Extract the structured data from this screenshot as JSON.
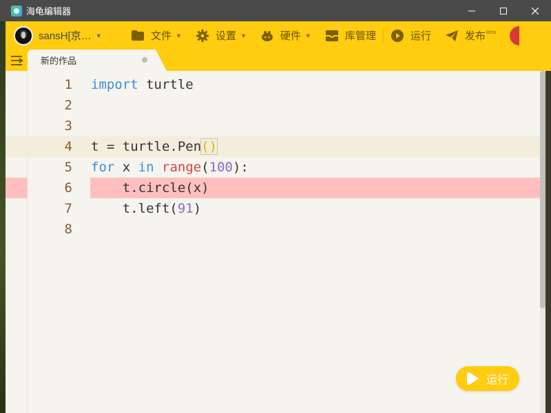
{
  "window": {
    "title": "海龟编辑器",
    "controls": {
      "minimize": "—",
      "maximize": "☐",
      "close": "✕"
    }
  },
  "toolbar": {
    "user_name": "sansH[京…",
    "items": [
      {
        "label": "文件",
        "icon": "folder-icon"
      },
      {
        "label": "设置",
        "icon": "gear-icon"
      },
      {
        "label": "硬件",
        "icon": "hardware-icon"
      },
      {
        "label": "库管理",
        "icon": "box-icon"
      },
      {
        "label": "运行",
        "icon": "play-icon"
      },
      {
        "label": "发布",
        "icon": "send-icon",
        "badge": "Beta"
      }
    ]
  },
  "tabs": [
    {
      "label": "新的作品"
    }
  ],
  "editor": {
    "line_numbers": [
      "1",
      "2",
      "3",
      "4",
      "5",
      "6",
      "7",
      "8"
    ],
    "lines": [
      "import turtle",
      "",
      "",
      "t = turtle.Pen()",
      "for x in range(100):",
      "    t.circle(x)",
      "    t.left(91)",
      ""
    ],
    "tokens": {
      "l1_kw": "import",
      "l1_rest": " turtle",
      "l4_a": "t = turtle.Pen",
      "l4_paren": "()",
      "l5_for": "for",
      "l5_x": " x ",
      "l5_in": "in",
      "l5_sp": " ",
      "l5_range": "range",
      "l5_open": "(",
      "l5_num": "100",
      "l5_close": "):",
      "l6": "    t.circle(x)",
      "l7_a": "    t.left(",
      "l7_num": "91",
      "l7_close": ")"
    },
    "active_line": 4,
    "error_line": 6
  },
  "run_button": {
    "label": "运行"
  },
  "colors": {
    "accent": "#ffcc10",
    "keyword": "#3a8edb",
    "builtin": "#d64545",
    "number": "#8a6bc4",
    "error_line_bg": "#ffbfbf",
    "active_line_bg": "#f4eddc"
  }
}
